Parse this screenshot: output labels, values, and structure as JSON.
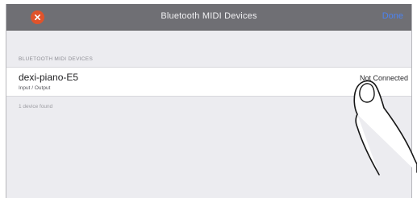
{
  "navbar": {
    "title": "Bluetooth MIDI Devices",
    "done_label": "Done",
    "close_icon": "close-x-icon"
  },
  "section": {
    "header": "BLUETOOTH MIDI DEVICES"
  },
  "devices": [
    {
      "name": "dexi-piano-E5",
      "detail": "Input / Output",
      "status": "Not Connected"
    }
  ],
  "footer": {
    "count_text": "1 device found"
  },
  "overlay": {
    "icon": "tapping-finger-icon"
  },
  "colors": {
    "navbar_bg": "#6f6f74",
    "close_red": "#e0532b",
    "done_blue": "#4c82f0",
    "panel_bg": "#ececf0"
  }
}
